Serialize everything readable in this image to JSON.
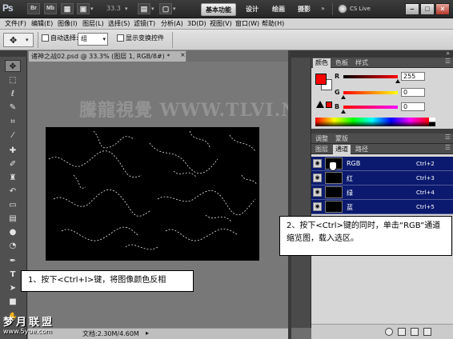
{
  "titlebar": {
    "app_logo": "Ps",
    "br_icon": "Br",
    "mb_icon": "Mb",
    "zoom": "33.3",
    "workspaces": [
      "基本功能",
      "设计",
      "绘画",
      "摄影"
    ],
    "more": "»",
    "cs_live": "CS Live",
    "window_buttons": [
      "–",
      "□",
      "×"
    ]
  },
  "menu": [
    "文件(F)",
    "编辑(E)",
    "图像(I)",
    "图层(L)",
    "选择(S)",
    "滤镜(T)",
    "分析(A)",
    "3D(D)",
    "视图(V)",
    "窗口(W)",
    "帮助(H)"
  ],
  "options": {
    "auto_select_label": "自动选择:",
    "auto_select_value": "组",
    "show_transform_label": "显示变换控件"
  },
  "document": {
    "tab_title": "诸神之战02.psd @ 33.3% (图层 1, RGB/8#) *",
    "close": "×",
    "watermark": "騰龍視覺 WWW.TLVI.NET",
    "status": "文档:2.30M/4.60M"
  },
  "color_panel": {
    "tabs": [
      "颜色",
      "色板",
      "样式"
    ],
    "r_label": "R",
    "g_label": "G",
    "b_label": "B",
    "r_value": "255",
    "g_value": "0",
    "b_value": "0",
    "foreground_color": "#ff0000",
    "background_color": "#ffffff"
  },
  "channels_panel": {
    "tabs": [
      "调整",
      "蒙版",
      "图层",
      "通道",
      "路径"
    ],
    "channels": [
      {
        "name": "RGB",
        "shortcut": "Ctrl+2"
      },
      {
        "name": "红",
        "shortcut": "Ctrl+3"
      },
      {
        "name": "绿",
        "shortcut": "Ctrl+4"
      },
      {
        "name": "蓝",
        "shortcut": "Ctrl+5"
      }
    ]
  },
  "callouts": {
    "step1": "1、按下<Ctrl+I>键，将图像颜色反相",
    "step2": "2、按下<Ctrl>键的同时，单击“RGB”通道缩览图，载入选区。"
  },
  "branding": {
    "logo": "梦月联盟",
    "url": "www.5yue.com"
  },
  "icons": {
    "tools": [
      "move-tool-icon",
      "marquee-tool-icon",
      "lasso-tool-icon",
      "quick-select-tool-icon",
      "crop-tool-icon",
      "eyedropper-tool-icon",
      "healing-brush-icon",
      "brush-tool-icon",
      "clone-stamp-icon",
      "history-brush-icon",
      "eraser-tool-icon",
      "gradient-tool-icon",
      "blur-tool-icon",
      "dodge-tool-icon",
      "pen-tool-icon",
      "type-tool-icon",
      "path-select-icon",
      "shape-tool-icon",
      "hand-tool-icon",
      "zoom-tool-icon"
    ]
  }
}
